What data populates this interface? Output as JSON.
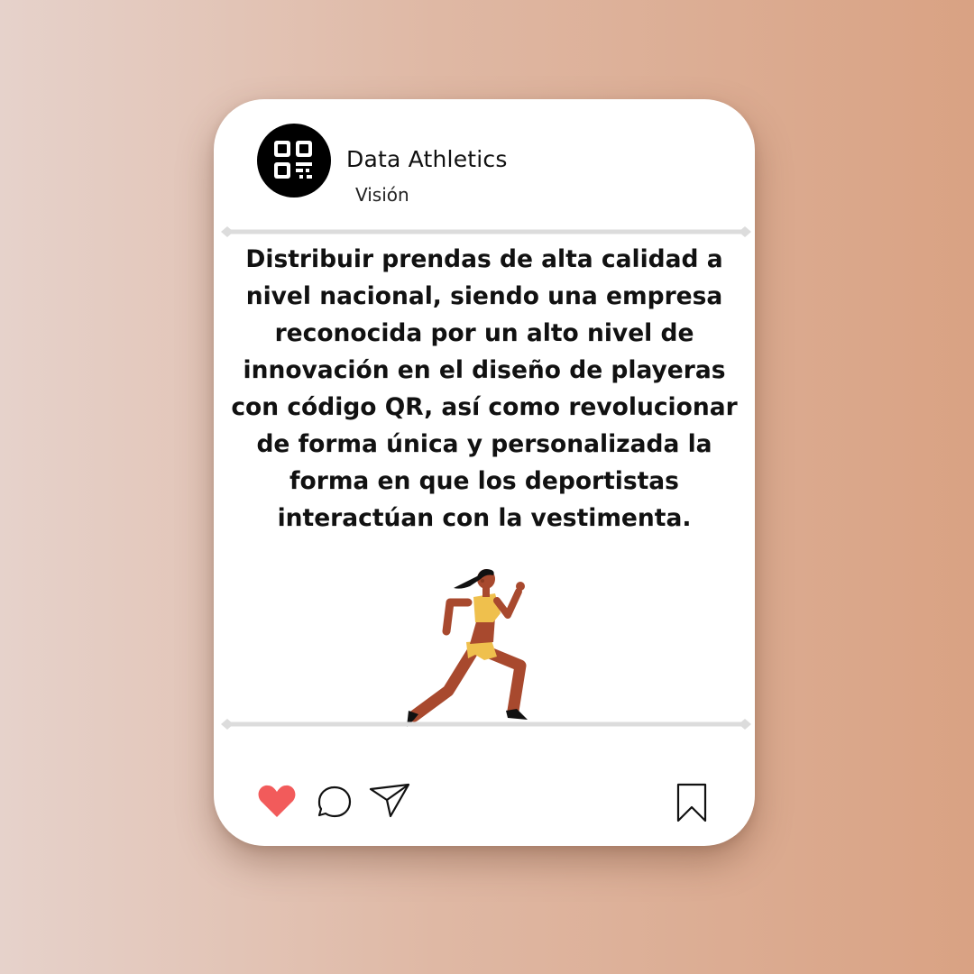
{
  "post": {
    "account_name": "Data Athletics",
    "subtitle": "Visión",
    "body": "Distribuir prendas de alta calidad a nivel nacional, siendo una empresa reconocida por un alto nivel de innovación en el diseño de playeras con código QR, así como revolucionar de forma única y personalizada la forma en que los deportistas interactúan con la vestimenta."
  },
  "icons": {
    "avatar": "qr-code-icon",
    "illustration": "runner-illustration",
    "like": "heart-icon",
    "comment": "comment-icon",
    "share": "send-icon",
    "save": "bookmark-icon"
  },
  "colors": {
    "like_active": "#f25b5b",
    "card": "#ffffff",
    "text": "#111111"
  }
}
